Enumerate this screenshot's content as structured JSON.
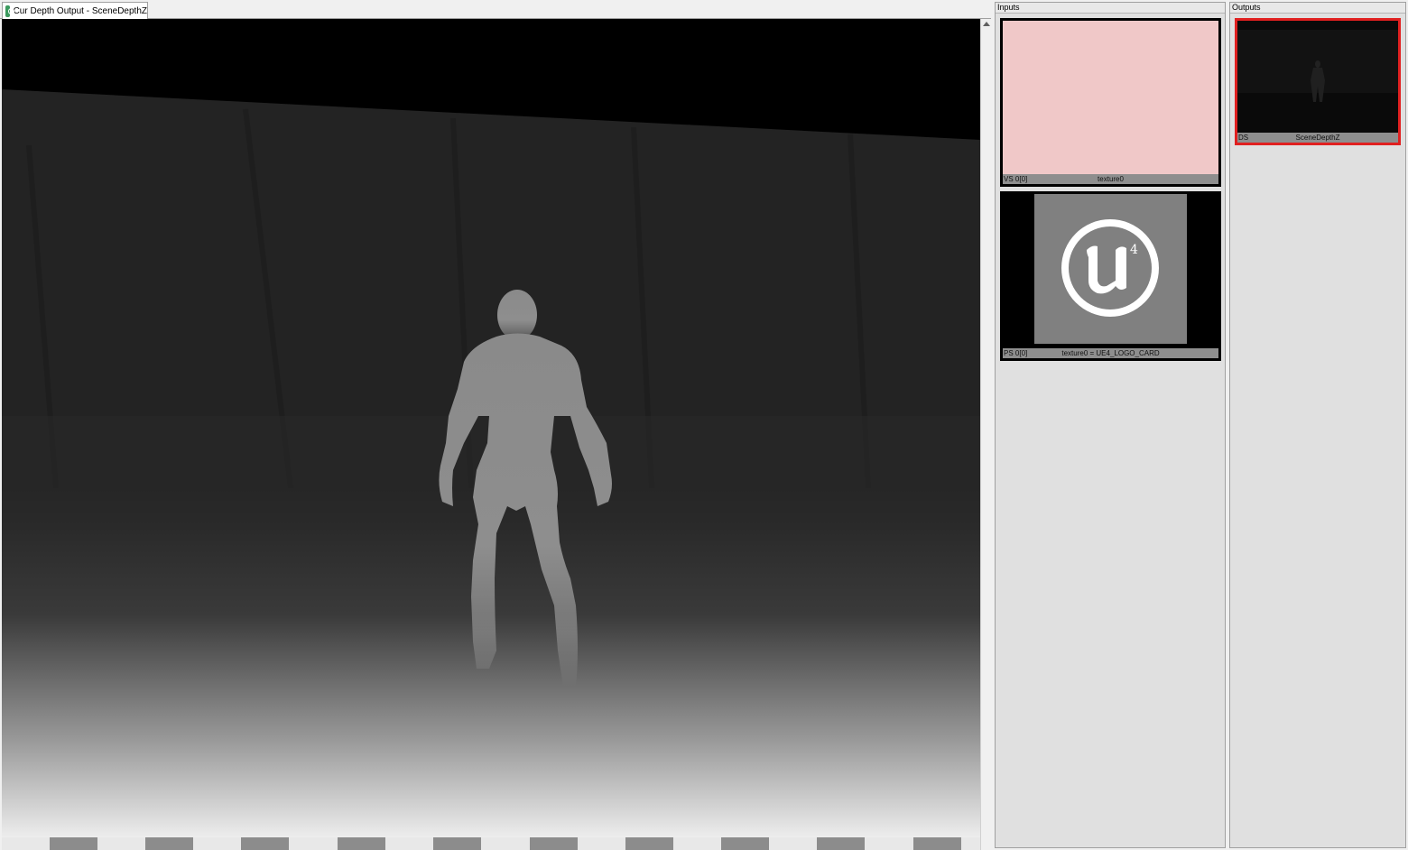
{
  "tab": {
    "label": "Cur Depth Output - SceneDepthZ",
    "icon": "texture-viewer-icon"
  },
  "inputs_panel": {
    "title": "Inputs",
    "thumbnails": [
      {
        "slot": "VS 0[0]",
        "name": "texture0",
        "fill": "#f0c8c8"
      },
      {
        "slot": "PS 0[0]",
        "name": "texture0 = UE4_LOGO_CARD",
        "logo": "ue4-logo-icon"
      }
    ]
  },
  "outputs_panel": {
    "title": "Outputs",
    "thumbnails": [
      {
        "slot": "DS",
        "name": "SceneDepthZ",
        "selected": true
      }
    ]
  },
  "colors": {
    "selected_border": "#e02020",
    "pink_texture": "#f0c8c8",
    "logo_bg": "#808080"
  }
}
